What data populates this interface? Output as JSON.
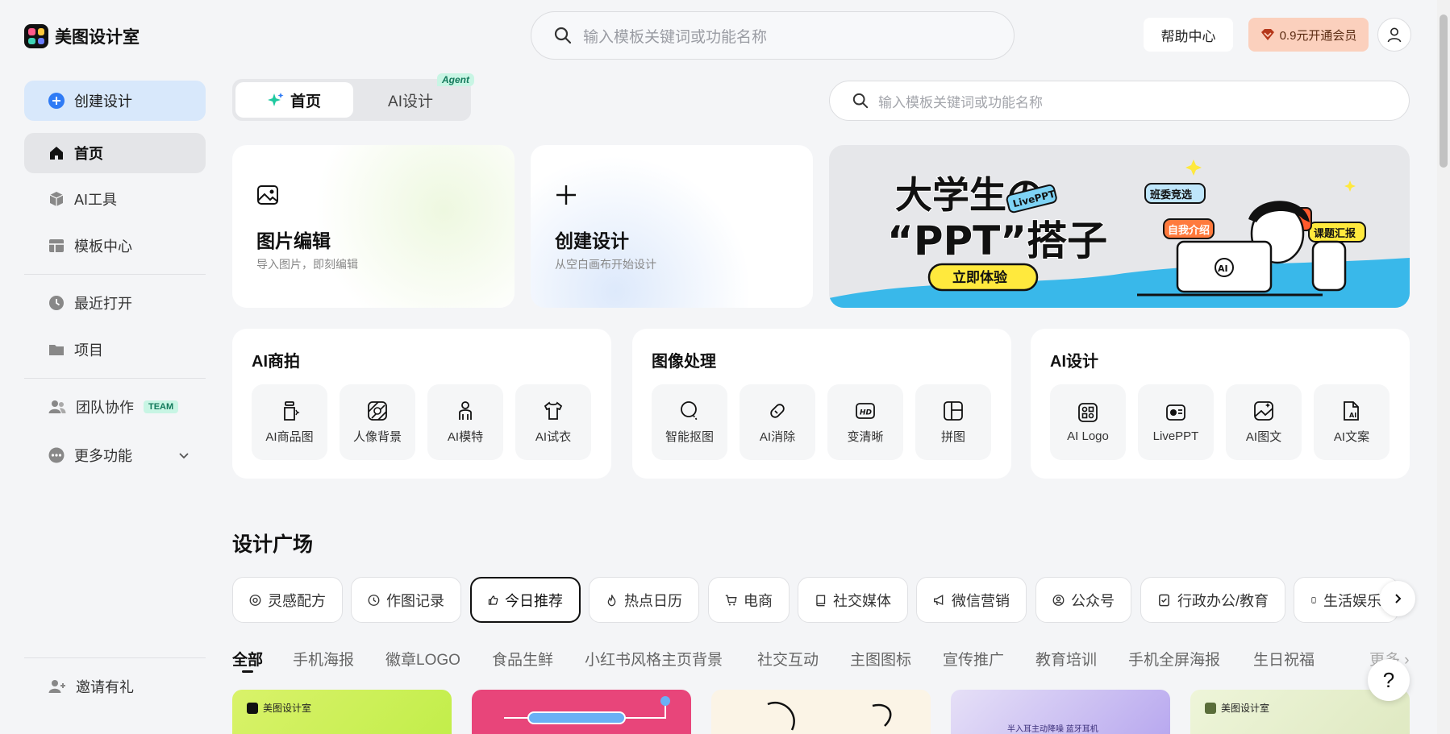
{
  "app": {
    "name": "美图设计室"
  },
  "header": {
    "search_placeholder": "输入模板关键词或功能名称",
    "help_label": "帮助中心",
    "vip_label": "0.9元开通会员"
  },
  "sidebar": {
    "create_label": "创建设计",
    "items": [
      {
        "label": "首页"
      },
      {
        "label": "AI工具"
      },
      {
        "label": "模板中心"
      },
      {
        "label": "最近打开"
      },
      {
        "label": "项目"
      },
      {
        "label": "团队协作",
        "badge": "TEAM"
      },
      {
        "label": "更多功能"
      }
    ],
    "invite_label": "邀请有礼"
  },
  "main": {
    "tabs": [
      {
        "label": "首页"
      },
      {
        "label": "AI设计",
        "badge": "Agent"
      }
    ],
    "search_placeholder": "输入模板关键词或功能名称",
    "cards": [
      {
        "title": "图片编辑",
        "subtitle": "导入图片，即刻编辑"
      },
      {
        "title": "创建设计",
        "subtitle": "从空白画布开始设计"
      }
    ],
    "banner": {
      "title_line1": "大学生の",
      "title_line2": "“PPT”搭子",
      "tag": "LivePPT",
      "cta": "立即体验",
      "bubbles": [
        "班委竞选",
        "自我介绍",
        "课题汇报"
      ],
      "laptop_mark": "AI"
    },
    "sections": [
      {
        "title": "AI商拍",
        "tools": [
          {
            "label": "AI商品图"
          },
          {
            "label": "人像背景"
          },
          {
            "label": "AI模特"
          },
          {
            "label": "AI试衣"
          }
        ]
      },
      {
        "title": "图像处理",
        "tools": [
          {
            "label": "智能抠图"
          },
          {
            "label": "AI消除"
          },
          {
            "label": "变清晰"
          },
          {
            "label": "拼图"
          }
        ]
      },
      {
        "title": "AI设计",
        "tools": [
          {
            "label": "AI Logo"
          },
          {
            "label": "LivePPT"
          },
          {
            "label": "AI图文"
          },
          {
            "label": "AI文案"
          }
        ]
      }
    ],
    "square_title": "设计广场",
    "chips": [
      {
        "label": "灵感配方"
      },
      {
        "label": "作图记录"
      },
      {
        "label": "今日推荐"
      },
      {
        "label": "热点日历"
      },
      {
        "label": "电商"
      },
      {
        "label": "社交媒体"
      },
      {
        "label": "微信营销"
      },
      {
        "label": "公众号"
      },
      {
        "label": "行政办公/教育"
      },
      {
        "label": "生活娱乐"
      }
    ],
    "categories": [
      "全部",
      "手机海报",
      "徽章LOGO",
      "食品生鲜",
      "小红书风格主页背景",
      "社交互动",
      "主图图标",
      "宣传推广",
      "教育培训",
      "手机全屏海报",
      "生日祝福"
    ],
    "more_label": "更多",
    "thumbs": [
      {
        "label": "美图设计室"
      },
      {
        "label": ""
      },
      {
        "label": ""
      },
      {
        "label": "半入耳主动降噪 蓝牙耳机"
      },
      {
        "label": "美图设计室"
      }
    ],
    "help_fab": "?"
  },
  "colors": {
    "accent_blue": "#2f7bf5",
    "create_bg": "#d8e8fb",
    "vip_bg": "#fbd0bd",
    "team_badge": "#c8f5e4"
  }
}
